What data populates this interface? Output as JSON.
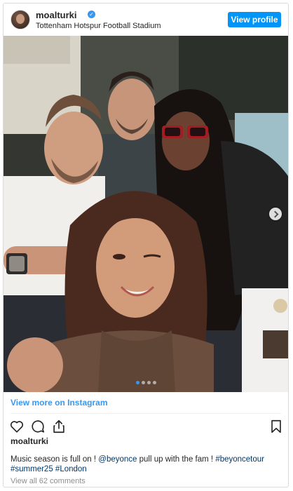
{
  "header": {
    "username": "moalturki",
    "location": "Tottenham Hotspur Football Stadium",
    "view_profile_label": "View profile"
  },
  "post": {
    "image_alt": "Selfie of four friends at a stadium",
    "carousel": {
      "count": 4,
      "active_index": 0
    }
  },
  "footer": {
    "view_more_label": "View more on Instagram",
    "liker_username": "moalturki",
    "caption_parts": [
      "Music season is full on ! ",
      "@beyonce",
      " pull up with the fam ! ",
      "#beyoncetour",
      " ",
      "#summer25",
      " ",
      "#London"
    ],
    "comments_label": "View all 62 comments"
  },
  "colors": {
    "accent": "#0095f6",
    "link": "#3897f0",
    "hashtag": "#00376b"
  },
  "icons": [
    "heart-icon",
    "comment-icon",
    "share-icon",
    "bookmark-icon",
    "verified-badge-icon",
    "chevron-right-icon"
  ]
}
